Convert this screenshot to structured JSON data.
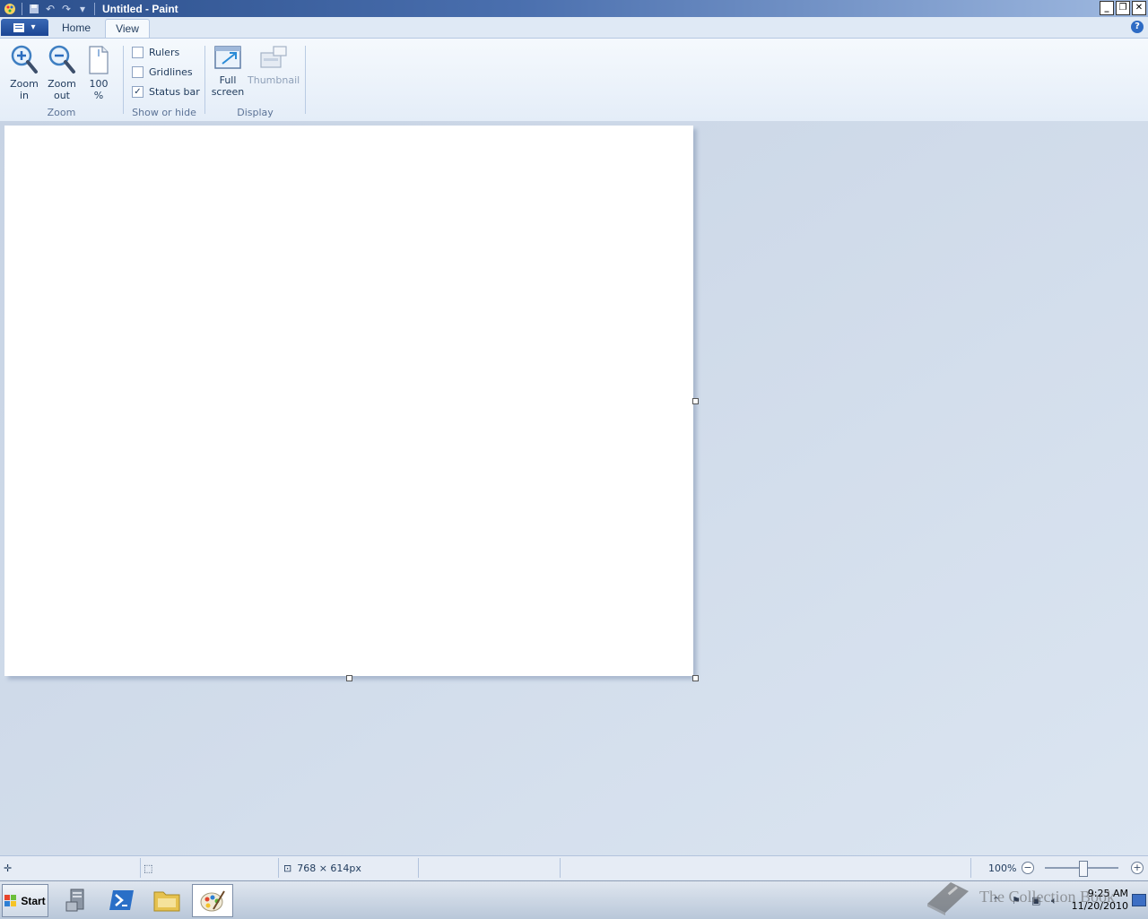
{
  "window": {
    "title": "Untitled - Paint"
  },
  "tabs": {
    "home": "Home",
    "view": "View"
  },
  "ribbon": {
    "zoom_group": {
      "label": "Zoom",
      "zoom_in": "Zoom\nin",
      "zoom_out": "Zoom\nout",
      "hundred": "100\n%"
    },
    "show_hide_group": {
      "label": "Show or hide",
      "rulers": "Rulers",
      "gridlines": "Gridlines",
      "status_bar": "Status bar",
      "rulers_checked": false,
      "gridlines_checked": false,
      "status_bar_checked": true
    },
    "display_group": {
      "label": "Display",
      "full_screen": "Full\nscreen",
      "thumbnail": "Thumbnail"
    }
  },
  "statusbar": {
    "size": "768 × 614px",
    "zoom": "100%",
    "zoom_level_percent": 100
  },
  "taskbar": {
    "start": "Start",
    "time": "9:25 AM",
    "date": "11/20/2010"
  },
  "watermark": {
    "text": "The Collection Book"
  },
  "colors": {
    "accent": "#2b4f8c",
    "workspace": "#c7d3e4",
    "canvas": "#ffffff"
  }
}
